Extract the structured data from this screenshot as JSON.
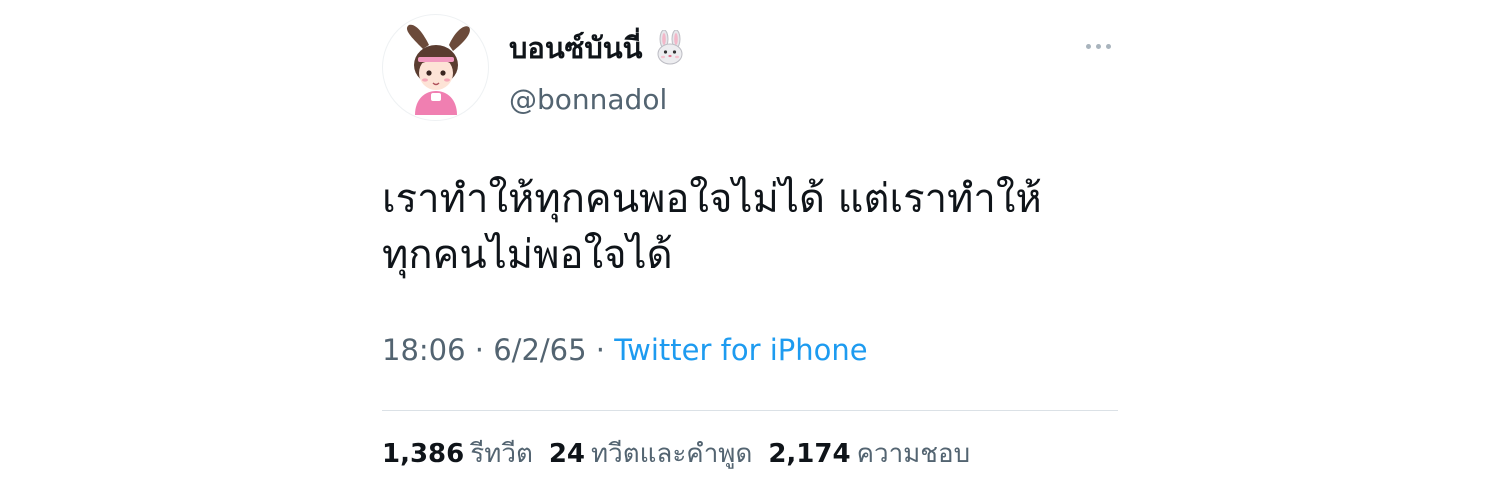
{
  "author": {
    "display_name": "บอนซ์บันนี่",
    "name_emoji_icon": "rabbit-face-icon",
    "handle": "@bonnadol",
    "avatar_icon": "cartoon-avatar-bunny-ears"
  },
  "tweet": {
    "text": "เราทำให้ทุกคนพอใจไม่ได้ แต่เราทำให้\nทุกคนไม่พอใจได้",
    "time": "18:06",
    "date": "6/2/65",
    "separator": "·",
    "source": "Twitter for iPhone"
  },
  "stats": {
    "retweets": {
      "count": "1,386",
      "label": "รีทวีต"
    },
    "quotes": {
      "count": "24",
      "label": "ทวีตและคำพูด"
    },
    "likes": {
      "count": "2,174",
      "label": "ความชอบ"
    }
  },
  "colors": {
    "text_primary": "#0f1419",
    "text_secondary": "#536471",
    "link": "#1d9bf0",
    "divider": "#dbe1e6"
  }
}
